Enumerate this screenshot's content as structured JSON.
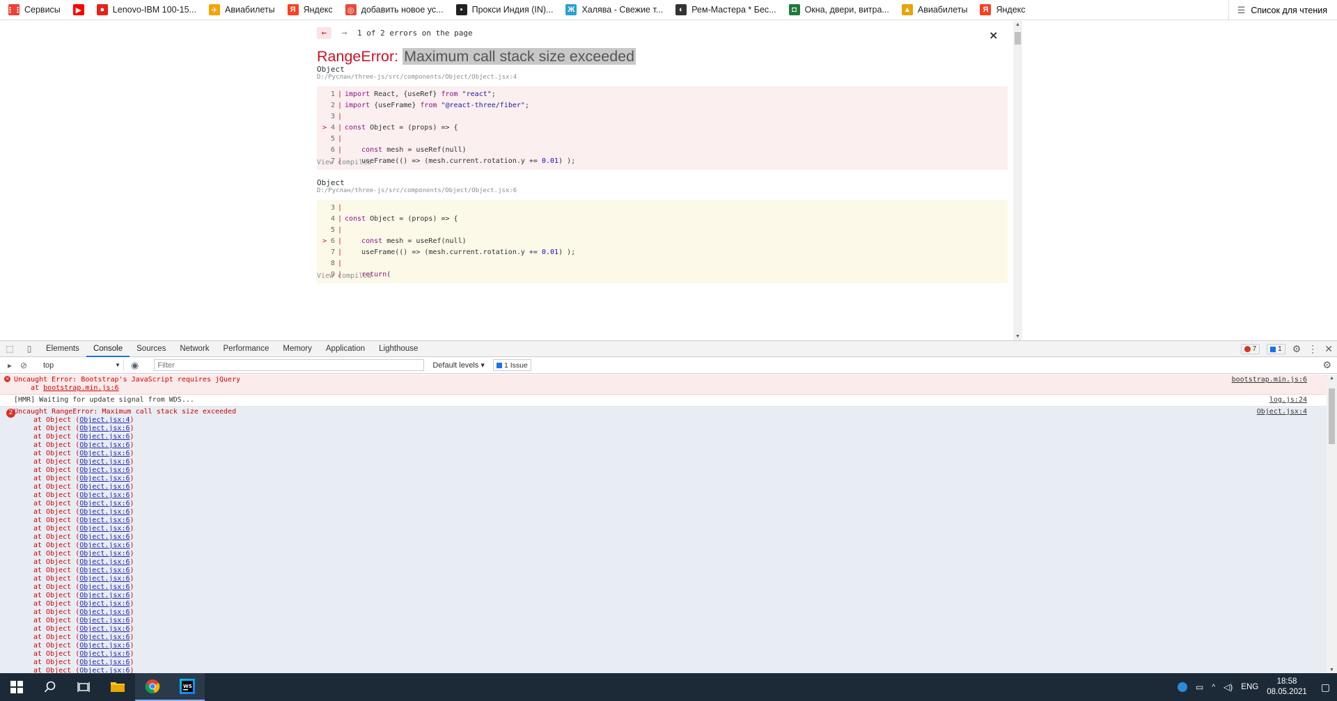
{
  "bookmarks": {
    "items": [
      {
        "label": "Сервисы",
        "icon": "apps-grid-icon",
        "color": "#ea4335"
      },
      {
        "label": "",
        "icon": "youtube-icon",
        "color": "#ff0000"
      },
      {
        "label": "Lenovo-IBM 100-15...",
        "icon": "lenovo-icon",
        "color": "#e2231a"
      },
      {
        "label": "Авиабилеты",
        "icon": "plane-icon",
        "color": "#f6a300"
      },
      {
        "label": "Яндекс",
        "icon": "yandex-icon",
        "color": "#fc3f1d"
      },
      {
        "label": "добавить новое ус...",
        "icon": "bookmark-icon",
        "color": "#e74c3c"
      },
      {
        "label": "Прокси Индия (IN)...",
        "icon": "proxy-icon",
        "color": "#222222"
      },
      {
        "label": "Халява - Свежие т...",
        "icon": "halyava-icon",
        "color": "#2aa1d3"
      },
      {
        "label": "Рем-Мастера * Бес...",
        "icon": "rem-master-icon",
        "color": "#333333"
      },
      {
        "label": "Окна, двери, витра...",
        "icon": "windows-doors-icon",
        "color": "#1f7a3a"
      },
      {
        "label": "Авиабилеты",
        "icon": "aviabilety-icon",
        "color": "#e8a400"
      },
      {
        "label": "Яндекс",
        "icon": "yandex-icon",
        "color": "#fc3f1d"
      }
    ],
    "reading_list": "Список для чтения"
  },
  "overlay": {
    "nav_prev": "←",
    "nav_next": "→",
    "counter": "1 of 2 errors on the page",
    "close": "×",
    "error_type": "RangeError:",
    "error_message": "Maximum call stack size exceeded",
    "frames": [
      {
        "name": "Object",
        "path": "D:/Руслан/three-js/src/components/Object/Object.jsx:4",
        "lines": [
          {
            "marker": "",
            "num": "1",
            "code": "import React, {useRef} from \"react\";"
          },
          {
            "marker": "",
            "num": "2",
            "code": "import {useFrame} from \"@react-three/fiber\";"
          },
          {
            "marker": "",
            "num": "3",
            "code": ""
          },
          {
            "marker": ">",
            "num": "4",
            "code": "const Object = (props) => {"
          },
          {
            "marker": "",
            "num": "5",
            "code": ""
          },
          {
            "marker": "",
            "num": "6",
            "code": "    const mesh = useRef(null)"
          },
          {
            "marker": "",
            "num": "7",
            "code": "    useFrame(() => (mesh.current.rotation.y += 0.01) );"
          }
        ],
        "view_compiled": "View compiled"
      },
      {
        "name": "Object",
        "path": "D:/Руслан/three-js/src/components/Object/Object.jsx:6",
        "lines": [
          {
            "marker": "",
            "num": "3",
            "code": ""
          },
          {
            "marker": "",
            "num": "4",
            "code": "const Object = (props) => {"
          },
          {
            "marker": "",
            "num": "5",
            "code": ""
          },
          {
            "marker": ">",
            "num": "6",
            "code": "    const mesh = useRef(null)"
          },
          {
            "marker": "",
            "num": "7",
            "code": "    useFrame(() => (mesh.current.rotation.y += 0.01) );"
          },
          {
            "marker": "",
            "num": "8",
            "code": ""
          },
          {
            "marker": "",
            "num": "9",
            "code": "    return("
          }
        ],
        "view_compiled": "View compiled"
      }
    ]
  },
  "devtools": {
    "tabs": [
      "Elements",
      "Console",
      "Sources",
      "Network",
      "Performance",
      "Memory",
      "Application",
      "Lighthouse"
    ],
    "active_tab": "Console",
    "error_count": "7",
    "message_count": "1",
    "context": "top",
    "filter_placeholder": "Filter",
    "levels": "Default levels ▾",
    "issues": "1 Issue",
    "messages": {
      "m1_line1": "Uncaught Error: Bootstrap's JavaScript requires jQuery",
      "m1_line2_prefix": "    at ",
      "m1_line2_link": "bootstrap.min.js:6",
      "m1_src": "bootstrap.min.js:6",
      "m2_text": "[HMR] Waiting for update signal from WDS...",
      "m2_src": "log.js:24",
      "m3_count": "2",
      "m3_text": "Uncaught RangeError: Maximum call stack size exceeded",
      "m3_src": "Object.jsx:4",
      "stack_prefix": "at Object (",
      "stack_first": "Object.jsx:4",
      "stack_repeat": "Object.jsx:6",
      "stack_suffix": ")",
      "stack_repeat_count": 30
    }
  },
  "taskbar": {
    "time": "18:58",
    "date": "08.05.2021",
    "lang": "ENG"
  }
}
